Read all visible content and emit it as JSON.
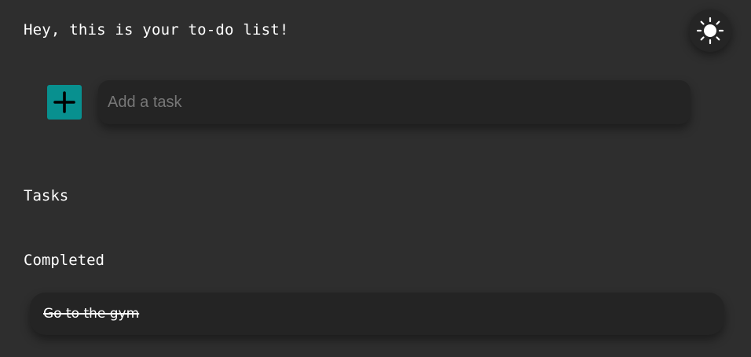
{
  "header": {
    "greeting": "Hey, this is your to-do list!",
    "theme_toggle_icon": "sun-icon"
  },
  "add_task": {
    "button_icon": "plus-icon",
    "input_placeholder": "Add a task",
    "input_value": ""
  },
  "sections": {
    "tasks_heading": "Tasks",
    "completed_heading": "Completed"
  },
  "completed_items": [
    {
      "label": "Go to the gym"
    }
  ],
  "colors": {
    "background": "#2e2e2e",
    "surface": "#242424",
    "accent": "#08908f",
    "text": "#ffffff",
    "placeholder": "#777777"
  }
}
